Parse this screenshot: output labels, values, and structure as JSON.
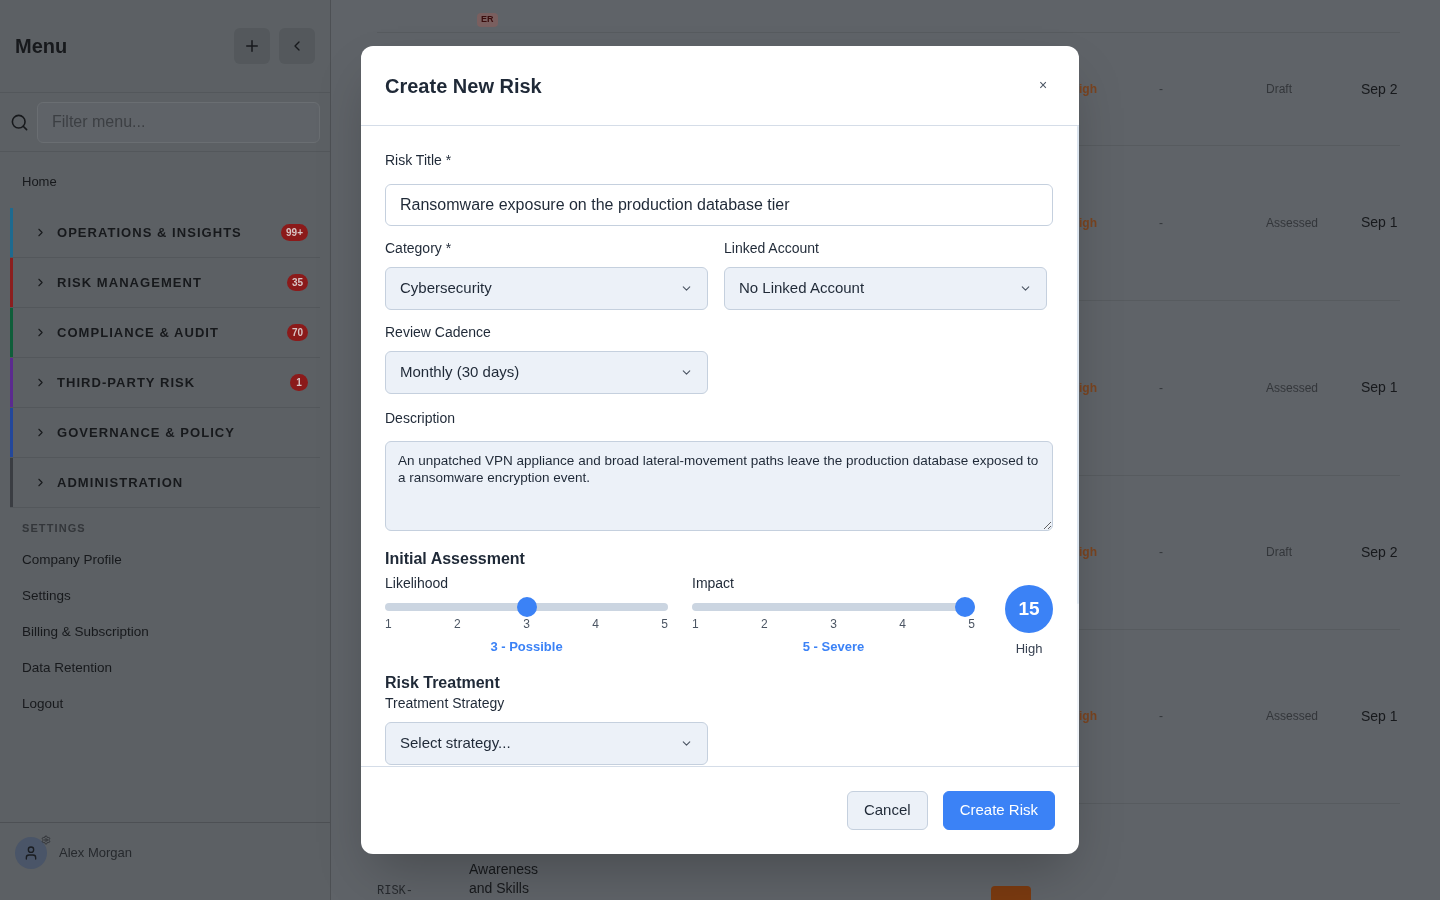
{
  "sidebar": {
    "title": "Menu",
    "filter_placeholder": "Filter menu...",
    "home": "Home",
    "groups": [
      {
        "label": "OPERATIONS & INSIGHTS",
        "badge": "99+",
        "color": "#1e6a8f"
      },
      {
        "label": "RISK MANAGEMENT",
        "badge": "35",
        "color": "#8b1e1e"
      },
      {
        "label": "COMPLIANCE & AUDIT",
        "badge": "70",
        "color": "#0f5e3a"
      },
      {
        "label": "THIRD-PARTY RISK",
        "badge": "1",
        "color": "#5b2a8f"
      },
      {
        "label": "GOVERNANCE & POLICY",
        "color": "#23479a"
      },
      {
        "label": "ADMINISTRATION",
        "color": "#3a3d42"
      }
    ],
    "settings_heading": "SETTINGS",
    "settings_items": [
      "Company Profile",
      "Settings",
      "Billing & Subscription",
      "Data Retention",
      "Logout"
    ],
    "user": "Alex Morgan"
  },
  "background_table": {
    "top_badge": "ER",
    "rows": [
      {
        "rating": "igh",
        "owner": "-",
        "status": "Draft",
        "date": "Sep 2"
      },
      {
        "rating": "igh",
        "owner": "-",
        "status": "Assessed",
        "date": "Sep 1"
      },
      {
        "rating": "igh",
        "owner": "-",
        "status": "Assessed",
        "date": "Sep 1"
      },
      {
        "rating": "igh",
        "owner": "-",
        "status": "Draft",
        "date": "Sep 2"
      },
      {
        "rating": "igh",
        "owner": "-",
        "status": "Assessed",
        "date": "Sep 1"
      }
    ],
    "partial_row": {
      "id": "RISK-",
      "title": "Awareness and Skills"
    }
  },
  "modal": {
    "title": "Create New Risk",
    "close": "×",
    "risk_title": {
      "label": "Risk Title *",
      "value": "Ransomware exposure on the production database tier"
    },
    "category": {
      "label": "Category *",
      "value": "Cybersecurity"
    },
    "linked_account": {
      "label": "Linked Account",
      "value": "No Linked Account"
    },
    "review_cadence": {
      "label": "Review Cadence",
      "value": "Monthly (30 days)"
    },
    "description": {
      "label": "Description",
      "value": "An unpatched VPN appliance and broad lateral-movement paths leave the production database exposed to a ransomware encryption event."
    },
    "assessment": {
      "heading": "Initial Assessment",
      "sliders": [
        {
          "label": "Likelihood",
          "level": 0.5,
          "ticks": [
            "1",
            "2",
            "3",
            "4",
            "5"
          ],
          "reading": "3 - Possible"
        },
        {
          "label": "Impact",
          "level": 1,
          "ticks": [
            "1",
            "2",
            "3",
            "4",
            "5"
          ],
          "reading": "5 - Severe"
        }
      ],
      "score": "15",
      "score_label": "High"
    },
    "treatment": {
      "heading": "Risk Treatment",
      "label": "Treatment Strategy",
      "value": "Select strategy..."
    },
    "buttons": [
      {
        "label": "Cancel",
        "kind": "secondary"
      },
      {
        "label": "Create Risk",
        "kind": "primary"
      }
    ]
  }
}
